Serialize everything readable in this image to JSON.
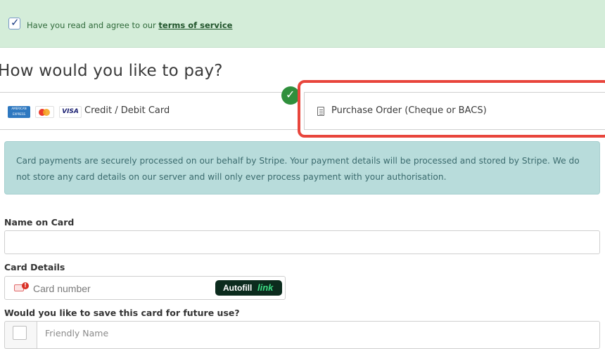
{
  "terms": {
    "text": "Have you read and agree to our ",
    "link": "terms of service",
    "checked": true
  },
  "payment": {
    "title": "How would you like to pay?",
    "options": [
      {
        "label": "Credit / Debit Card",
        "selected": true,
        "icons": [
          "amex-card-icon",
          "mastercard-icon",
          "visa-card-icon"
        ]
      },
      {
        "label": "Purchase Order (Cheque or BACS)",
        "selected": false,
        "icons": [
          "document-icon"
        ]
      }
    ],
    "card_brand_texts": {
      "amex": "AMERICAN EXPRESS",
      "visa": "VISA"
    }
  },
  "info": {
    "text": "Card payments are securely processed on our behalf by Stripe. Your payment details will be processed and stored by Stripe. We do not store any card details on our server and will only ever process payment with your authorisation."
  },
  "form": {
    "name_label": "Name on Card",
    "name_value": "",
    "card_label": "Card Details",
    "card_placeholder": "Card number",
    "autofill_text": "Autofill",
    "autofill_link": "link",
    "save_label": "Would you like to save this card for future use?",
    "friendly_placeholder": "Friendly Name"
  },
  "colors": {
    "success": "#2f8f3c",
    "highlight": "#e8453c",
    "info_bg": "#b8dcdb",
    "terms_bg": "#d4edd9",
    "autofill_bg": "#0b2b1d",
    "autofill_accent": "#3ddc84"
  }
}
